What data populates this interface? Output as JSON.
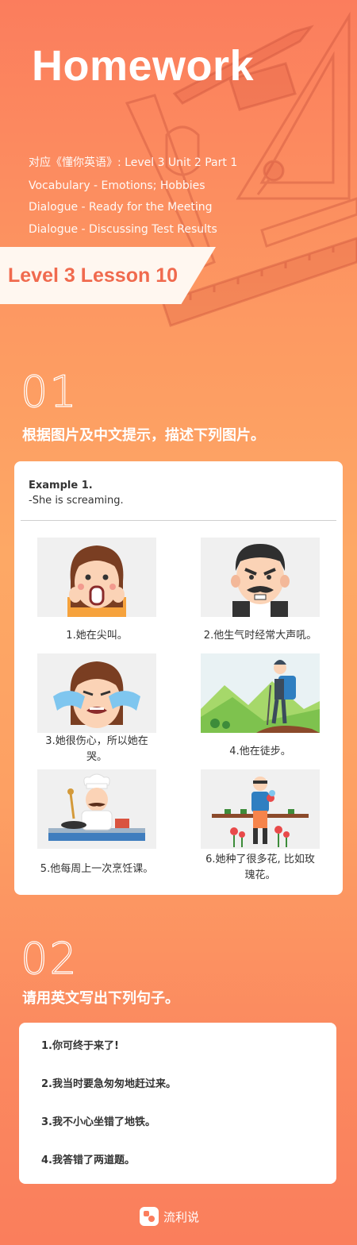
{
  "header": {
    "title": "Homework",
    "course_line": "对应《懂你英语》: Level 3 Unit 2 Part 1",
    "topics": [
      "Vocabulary - Emotions; Hobbies",
      "Dialogue - Ready for the Meeting",
      "Dialogue - Discussing Test Results"
    ],
    "lesson": "Level 3 Lesson 10"
  },
  "section1": {
    "number": "01",
    "heading": "根据图片及中文提示，描述下列图片。",
    "example_title": "Example 1.",
    "example_sentence": "-She is screaming.",
    "items": [
      {
        "caption": "1.她在尖叫。",
        "icon": "screaming-woman"
      },
      {
        "caption": "2.他生气时经常大声吼。",
        "icon": "angry-man"
      },
      {
        "caption": "3.她很伤心，所以她在哭。",
        "icon": "crying-woman"
      },
      {
        "caption": "4.他在徒步。",
        "icon": "hiker"
      },
      {
        "caption": "5.他每周上一次烹饪课。",
        "icon": "chef"
      },
      {
        "caption": "6.她种了很多花, 比如玫瑰花。",
        "icon": "gardener"
      }
    ]
  },
  "section2": {
    "number": "02",
    "heading": "请用英文写出下列句子。",
    "sentences": [
      "1.你可终于来了!",
      "2.我当时要急匆匆地赶过来。",
      "3.我不小心坐错了地铁。",
      "4.我答错了两道题。"
    ]
  },
  "footer": {
    "brand": "流利说"
  },
  "colors": {
    "accent": "#f06a4e",
    "bg_top": "#fb7d5d",
    "bg_mid": "#fda865"
  }
}
